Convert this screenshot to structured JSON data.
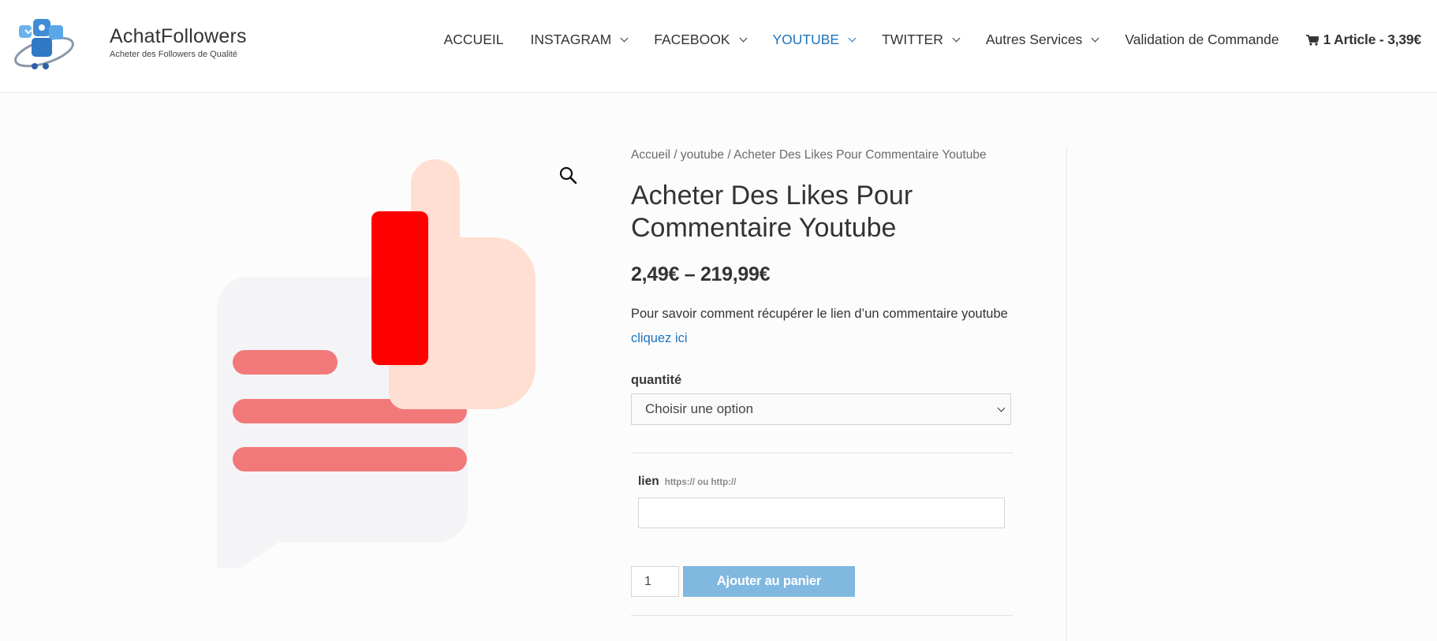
{
  "header": {
    "brand_name": "AchatFollowers",
    "brand_tagline": "Acheter des Followers de Qualité",
    "nav": [
      {
        "label": "ACCUEIL",
        "has_dropdown": false
      },
      {
        "label": "INSTAGRAM",
        "has_dropdown": true
      },
      {
        "label": "FACEBOOK",
        "has_dropdown": true
      },
      {
        "label": "YOUTUBE",
        "has_dropdown": true,
        "active": true
      },
      {
        "label": "TWITTER",
        "has_dropdown": true
      },
      {
        "label": "Autres Services",
        "has_dropdown": true
      },
      {
        "label": "Validation de Commande",
        "has_dropdown": false
      }
    ],
    "cart_label": "1 Article - 3,39€"
  },
  "breadcrumb": {
    "home": "Accueil",
    "sep": " / ",
    "category": "youtube",
    "current": "Acheter Des Likes Pour Commentaire Youtube"
  },
  "product": {
    "title_line1": "Acheter Des Likes Pour",
    "title_line2": "Commentaire Youtube",
    "price": "2,49€ – 219,99€",
    "description": "Pour savoir comment récupérer le lien d’un commentaire youtube",
    "description_link": "cliquez ici",
    "quantity_label": "quantité",
    "quantity_select_value": "Choisir une option",
    "lien_label": "lien",
    "lien_hint": "https:// ou http://",
    "lien_value": "",
    "qty_value": "1",
    "add_to_cart": "Ajouter au panier"
  },
  "colors": {
    "accent": "#1e73be",
    "button": "#80b8e0",
    "thumb_cuff": "#ff0000",
    "thumb_skin": "#ffdfd2",
    "bubble": "#f4f4f6",
    "lines": "#f27979"
  },
  "icons": {
    "zoom": "magnifier-icon",
    "cart": "cart-icon"
  }
}
